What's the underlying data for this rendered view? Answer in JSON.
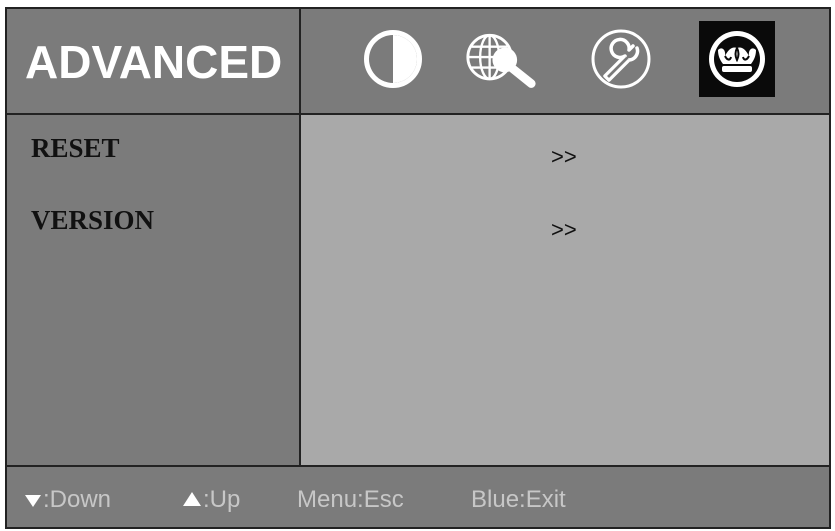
{
  "header": {
    "title": "ADVANCED",
    "icons": [
      {
        "name": "picture-contrast-icon",
        "selected": false
      },
      {
        "name": "globe-search-icon",
        "selected": false
      },
      {
        "name": "wrench-icon",
        "selected": false
      },
      {
        "name": "crown-icon",
        "selected": true
      }
    ]
  },
  "menu": {
    "items": [
      {
        "label": "RESET",
        "value": ">>"
      },
      {
        "label": "VERSION",
        "value": ">>"
      }
    ]
  },
  "footer": {
    "down_label": ":Down",
    "up_label": ":Up",
    "menu_label": "Menu:Esc",
    "blue_label": "Blue:Exit"
  },
  "colors": {
    "panel": "#7b7b7b",
    "content": "#a9a9a9",
    "selected_icon_bg": "#0a0a0a",
    "title_text": "#ffffff",
    "hint_text": "#c7c7c7"
  }
}
